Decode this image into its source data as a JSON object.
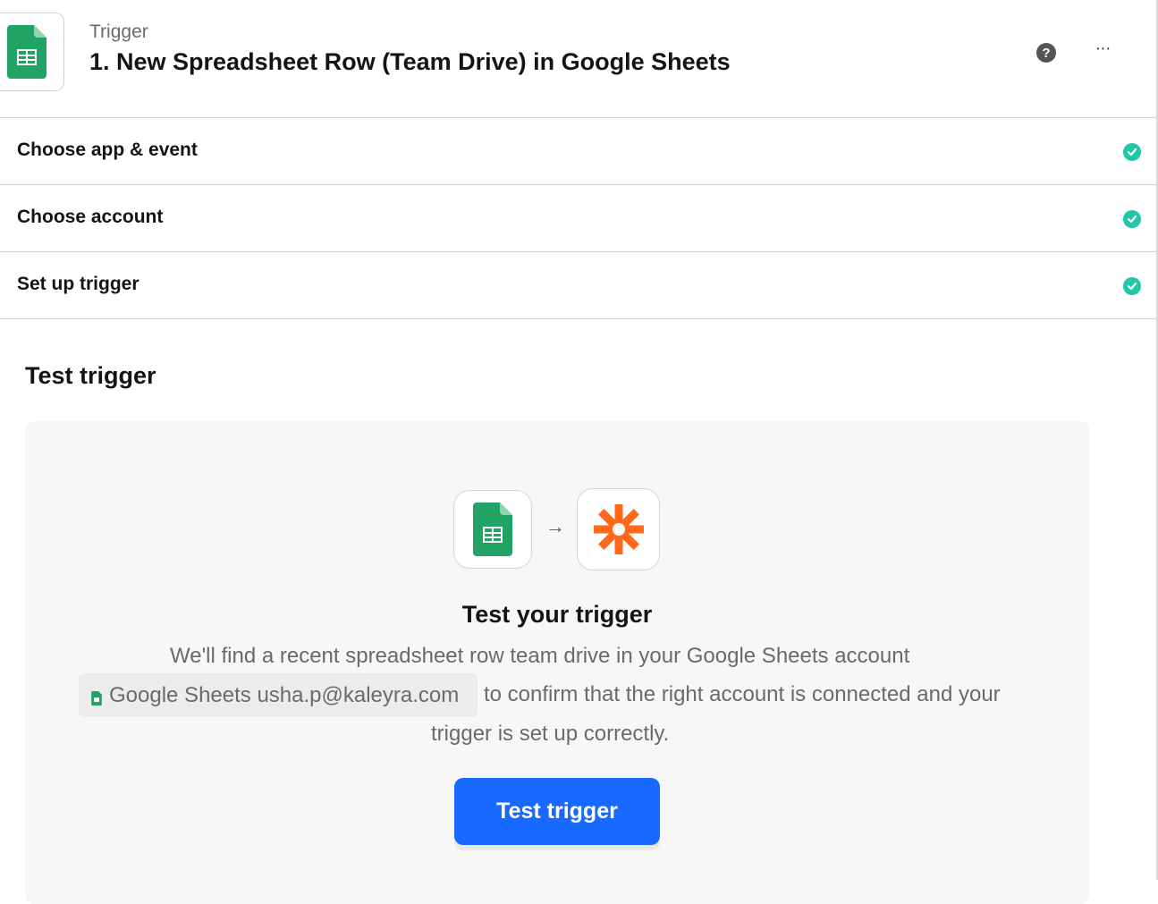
{
  "header": {
    "kicker": "Trigger",
    "title": "1. New Spreadsheet Row (Team Drive) in Google Sheets",
    "help_glyph": "?",
    "more_glyph": "···"
  },
  "steps": [
    {
      "label": "Choose app & event",
      "complete": true
    },
    {
      "label": "Choose account",
      "complete": true
    },
    {
      "label": "Set up trigger",
      "complete": true
    }
  ],
  "test_section": {
    "title": "Test trigger",
    "heading": "Test your trigger",
    "desc_line1": "We'll find a recent spreadsheet row team drive in your Google Sheets account",
    "account_chip": "Google Sheets usha.p@kaleyra.com",
    "desc_line2_rest": "to confirm that the right account is connected and your",
    "desc_line3": "trigger is set up correctly.",
    "arrow_glyph": "→",
    "button_label": "Test trigger"
  },
  "icons": {
    "source_app": "google-sheets-icon",
    "target_app": "zapier-icon",
    "check": "check-circle-icon"
  },
  "colors": {
    "check": "#21c8a7",
    "primary_button": "#1769ff",
    "sheets_green": "#21a366",
    "zapier_orange": "#ff6a1a"
  }
}
